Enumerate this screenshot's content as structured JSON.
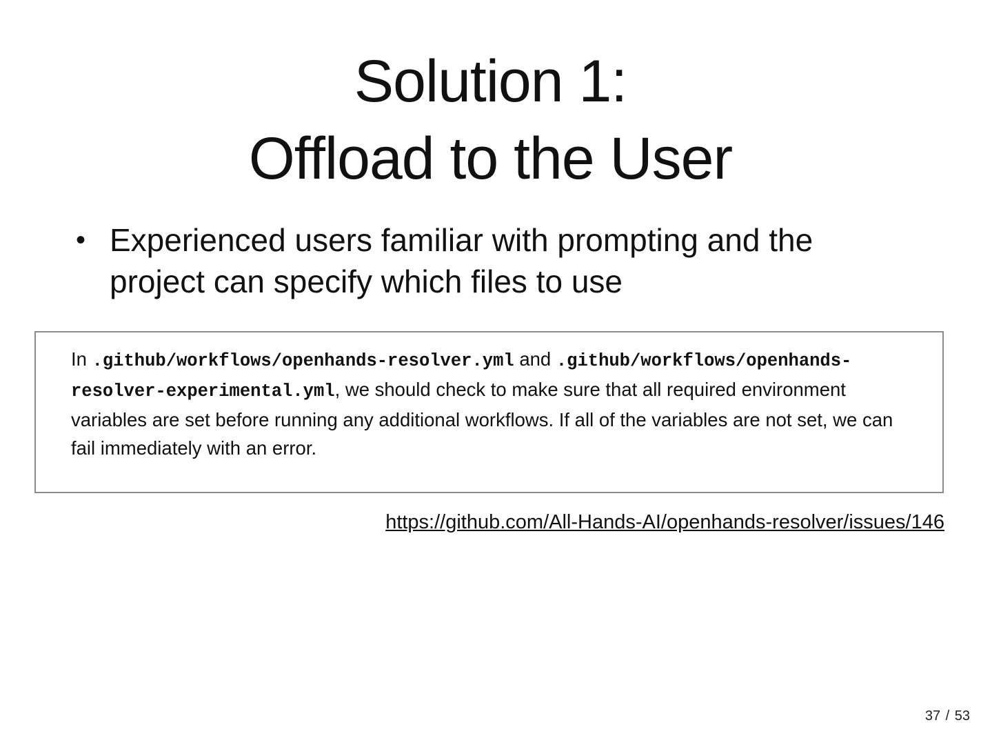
{
  "slide": {
    "title_line1": "Solution 1:",
    "title_line2": "Offload to the User",
    "bullets": [
      {
        "symbol": "•",
        "text": "Experienced users familiar with prompting and the project can specify which files to use"
      }
    ],
    "quote": {
      "prefix": "In ",
      "file1": ".github/workflows/openhands-resolver.yml",
      "joiner": " and ",
      "file2": ".github/workflows/openhands-resolver-experimental.yml",
      "rest": ", we should check to make sure that all required environment variables are set before running any additional workflows. If all of the variables are not set, we can fail immediately with an error."
    },
    "link": "https://github.com/All-Hands-AI/openhands-resolver/issues/146",
    "page_number": "37 / 53"
  }
}
